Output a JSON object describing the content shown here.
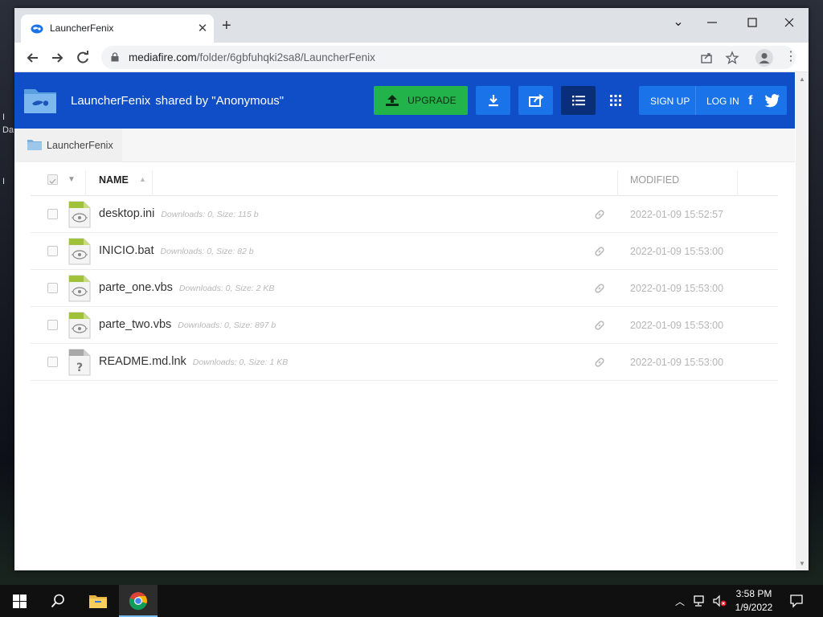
{
  "browser": {
    "tab_title": "LauncherFenix",
    "new_tab_symbol": "+",
    "url_host": "mediafire.com",
    "url_path": "/folder/6gbfuhqki2sa8/LauncherFenix"
  },
  "header": {
    "folder_name": "LauncherFenix",
    "shared_by": "shared by \"Anonymous\"",
    "upgrade_label": "UPGRADE",
    "signup_label": "SIGN UP",
    "login_label": "LOG IN",
    "brand_color": "#0f4ec7",
    "upgrade_color": "#22b34a"
  },
  "breadcrumb": {
    "label": "LauncherFenix"
  },
  "table": {
    "name_header": "NAME",
    "modified_header": "MODIFIED",
    "files": [
      {
        "name": "desktop.ini",
        "meta": "Downloads: 0, Size: 115 b",
        "modified": "2022-01-09 15:52:57",
        "icon": "script-file-icon"
      },
      {
        "name": "INICIO.bat",
        "meta": "Downloads: 0, Size: 82 b",
        "modified": "2022-01-09 15:53:00",
        "icon": "script-file-icon"
      },
      {
        "name": "parte_one.vbs",
        "meta": "Downloads: 0, Size: 2 KB",
        "modified": "2022-01-09 15:53:00",
        "icon": "script-file-icon"
      },
      {
        "name": "parte_two.vbs",
        "meta": "Downloads: 0, Size: 897 b",
        "modified": "2022-01-09 15:53:00",
        "icon": "script-file-icon"
      },
      {
        "name": "README.md.lnk",
        "meta": "Downloads: 0, Size: 1 KB",
        "modified": "2022-01-09 15:53:00",
        "icon": "unknown-file-icon"
      }
    ]
  },
  "taskbar": {
    "time": "3:58 PM",
    "date": "1/9/2022"
  }
}
